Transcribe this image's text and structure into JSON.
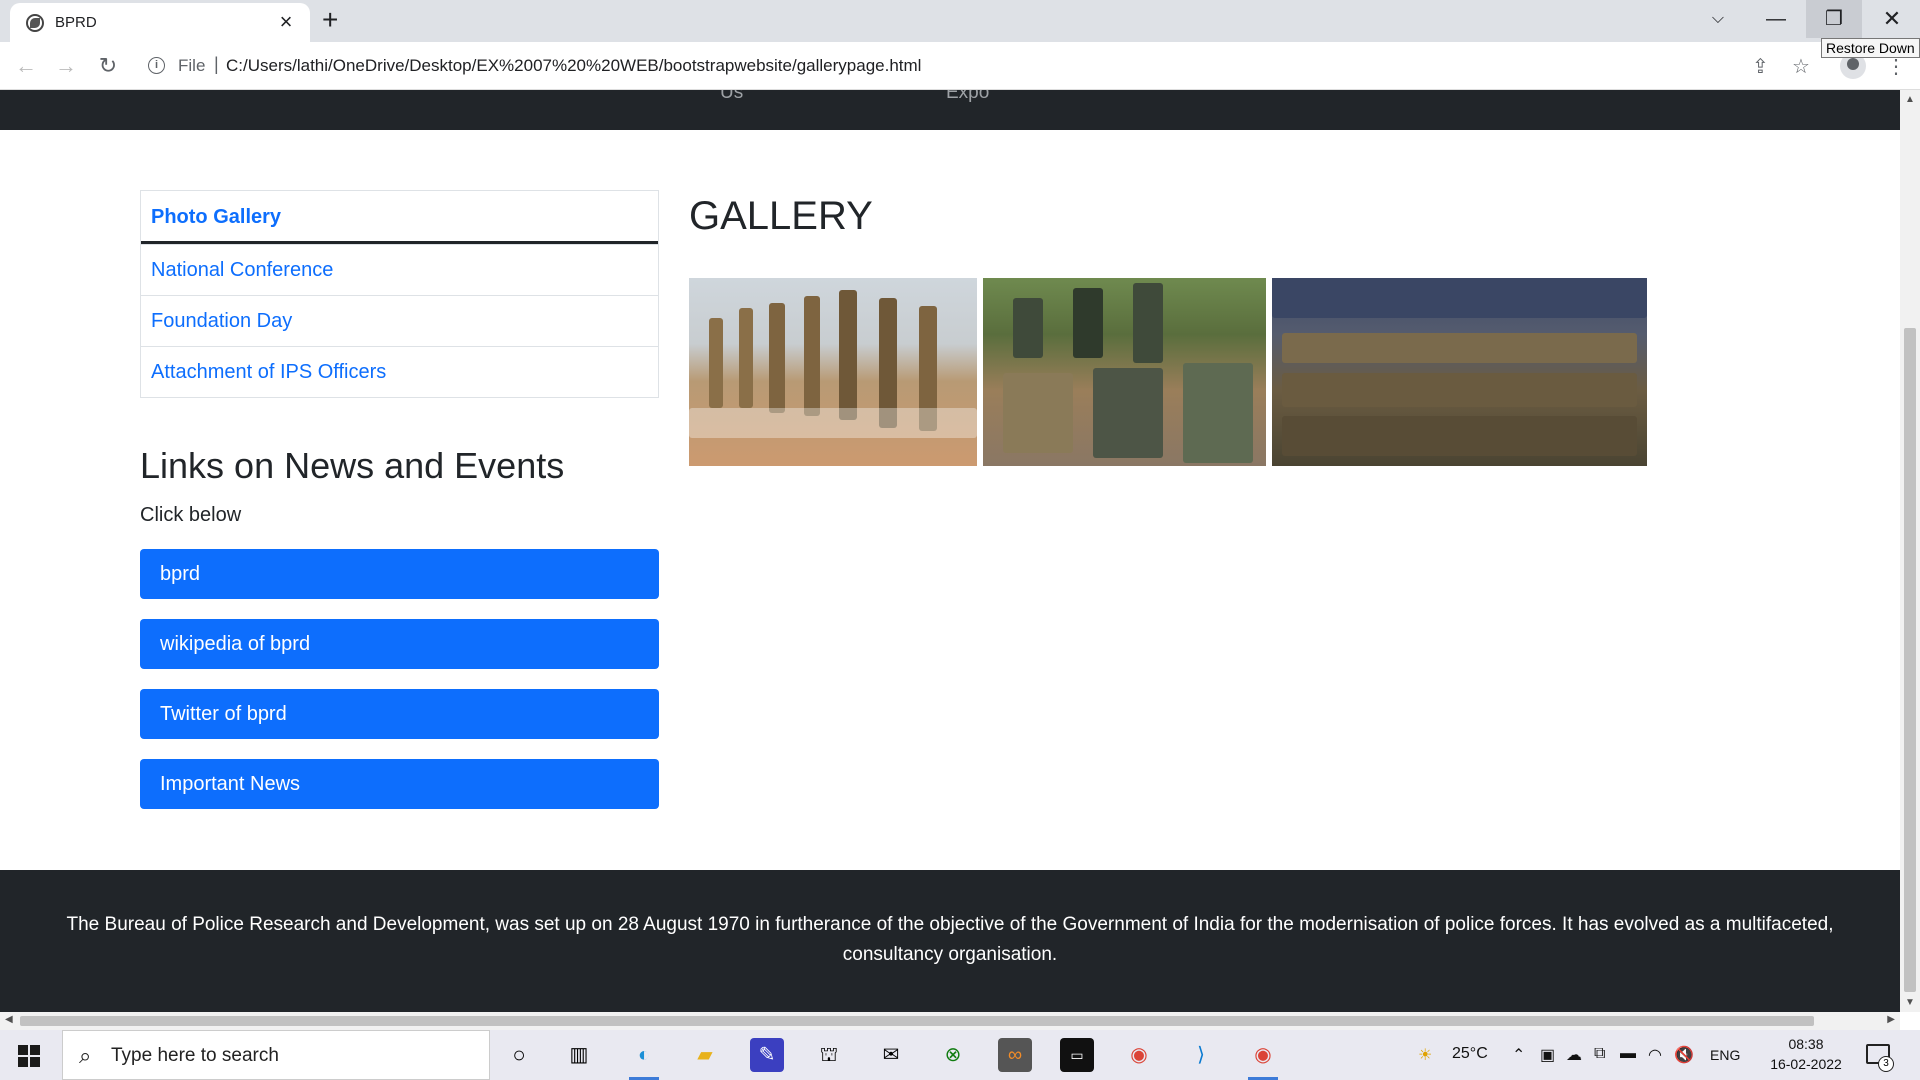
{
  "browser": {
    "tab_title": "BPRD",
    "tooltip": "Restore Down",
    "scheme": "File",
    "url": "C:/Users/lathi/OneDrive/Desktop/EX%2007%20%20WEB/bootstrapwebsite/gallerypage.html"
  },
  "navbar": {
    "fragment_1": "Us",
    "fragment_2": "Expo"
  },
  "sidebar": {
    "items": [
      {
        "label": "Photo Gallery"
      },
      {
        "label": "National Conference"
      },
      {
        "label": "Foundation Day"
      },
      {
        "label": "Attachment of IPS Officers"
      }
    ]
  },
  "links": {
    "heading": "Links on News and Events",
    "subtext": "Click below",
    "buttons": [
      {
        "label": "bprd"
      },
      {
        "label": "wikipedia of bprd"
      },
      {
        "label": "Twitter of bprd"
      },
      {
        "label": "Important News"
      }
    ]
  },
  "gallery": {
    "title": "GALLERY"
  },
  "footer": {
    "text": "The Bureau of Police Research and Development, was set up on 28 August 1970 in furtherance of the objective of the Government of India for the modernisation of police forces. It has evolved as a multifaceted, consultancy organisation."
  },
  "taskbar": {
    "search_placeholder": "Type here to search",
    "temperature": "25°C",
    "language": "ENG",
    "time": "08:38",
    "date": "16-02-2022",
    "notification_count": "3"
  },
  "colors": {
    "primary": "#0d6efd",
    "dark": "#212529"
  }
}
